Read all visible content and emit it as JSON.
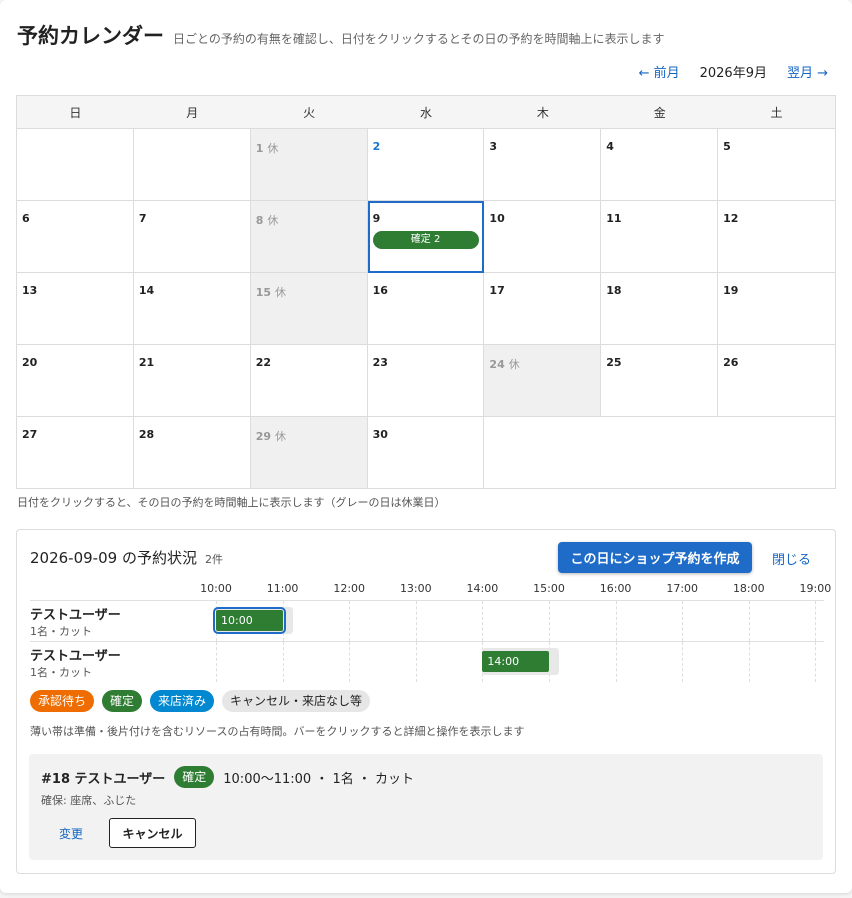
{
  "header": {
    "title": "予約カレンダー",
    "subtitle": "日ごとの予約の有無を確認し、日付をクリックするとその日の予約を時間軸上に表示します"
  },
  "nav": {
    "prev": "← 前月",
    "month": "2026年9月",
    "next": "翌月 →"
  },
  "weekdays": [
    "日",
    "月",
    "火",
    "水",
    "木",
    "金",
    "土"
  ],
  "closed_suffix": "休",
  "days": [
    {
      "d": "",
      "state": "empty"
    },
    {
      "d": "",
      "state": "empty"
    },
    {
      "d": "1",
      "state": "closed"
    },
    {
      "d": "2",
      "state": "today"
    },
    {
      "d": "3",
      "state": "normal"
    },
    {
      "d": "4",
      "state": "normal"
    },
    {
      "d": "5",
      "state": "normal"
    },
    {
      "d": "6",
      "state": "normal"
    },
    {
      "d": "7",
      "state": "normal"
    },
    {
      "d": "8",
      "state": "closed"
    },
    {
      "d": "9",
      "state": "selected",
      "badge": "確定 2"
    },
    {
      "d": "10",
      "state": "normal"
    },
    {
      "d": "11",
      "state": "normal"
    },
    {
      "d": "12",
      "state": "normal"
    },
    {
      "d": "13",
      "state": "normal"
    },
    {
      "d": "14",
      "state": "normal"
    },
    {
      "d": "15",
      "state": "closed"
    },
    {
      "d": "16",
      "state": "normal"
    },
    {
      "d": "17",
      "state": "normal"
    },
    {
      "d": "18",
      "state": "normal"
    },
    {
      "d": "19",
      "state": "normal"
    },
    {
      "d": "20",
      "state": "normal"
    },
    {
      "d": "21",
      "state": "normal"
    },
    {
      "d": "22",
      "state": "normal"
    },
    {
      "d": "23",
      "state": "normal"
    },
    {
      "d": "24",
      "state": "closed"
    },
    {
      "d": "25",
      "state": "normal"
    },
    {
      "d": "26",
      "state": "normal"
    },
    {
      "d": "27",
      "state": "normal"
    },
    {
      "d": "28",
      "state": "normal"
    },
    {
      "d": "29",
      "state": "closed"
    },
    {
      "d": "30",
      "state": "normal"
    },
    {
      "d": "",
      "state": "tail"
    },
    {
      "d": "",
      "state": "tail"
    },
    {
      "d": "",
      "state": "tail"
    }
  ],
  "calendar_note": "日付をクリックすると、その日の予約を時間軸上に表示します（グレーの日は休業日）",
  "panel": {
    "title": "2026-09-09 の予約状況",
    "count": "2件",
    "create_button": "この日にショップ予約を作成",
    "close_link": "閉じる",
    "hours": [
      "10:00",
      "11:00",
      "12:00",
      "13:00",
      "14:00",
      "15:00",
      "16:00",
      "17:00",
      "18:00",
      "19:00"
    ],
    "rows": [
      {
        "name": "テストユーザー",
        "meta": "1名・カット",
        "bar_label": "10:00",
        "start": 10.0,
        "end": 11.0,
        "occ_end": 11.15,
        "selected": true
      },
      {
        "name": "テストユーザー",
        "meta": "1名・カット",
        "bar_label": "14:00",
        "start": 14.0,
        "end": 15.0,
        "occ_end": 15.15,
        "selected": false
      }
    ],
    "legend": [
      {
        "label": "承認待ち",
        "cls": "pending"
      },
      {
        "label": "確定",
        "cls": "confirmed"
      },
      {
        "label": "来店済み",
        "cls": "visited"
      },
      {
        "label": "キャンセル・来店なし等",
        "cls": "cancelled"
      }
    ],
    "legend_note": "薄い帯は準備・後片付けを含むリソースの占有時間。バーをクリックすると詳細と操作を表示します",
    "detail": {
      "id_name": "#18 テストユーザー",
      "status": "確定",
      "summary": "10:00〜11:00 ・ 1名 ・ カット",
      "resources": "確保: 座席、ふじた",
      "edit": "変更",
      "cancel": "キャンセル"
    }
  },
  "colors": {
    "accent": "#1e6cc8",
    "confirmed": "#2e7d32",
    "pending": "#ef6c00",
    "visited": "#0288d1"
  }
}
